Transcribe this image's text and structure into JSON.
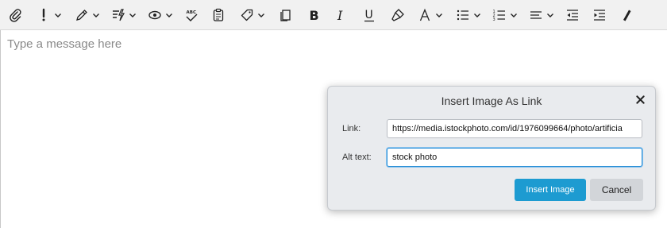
{
  "toolbar": {
    "items": [
      {
        "icon": "paperclip-icon"
      },
      {
        "icon": "priority-icon",
        "dropdown": true
      },
      {
        "icon": "signature-pen-icon",
        "dropdown": true
      },
      {
        "icon": "quick-text-icon",
        "dropdown": true
      },
      {
        "icon": "read-receipt-icon",
        "dropdown": true
      },
      {
        "icon": "spellcheck-icon"
      },
      {
        "icon": "clipboard-icon"
      },
      {
        "icon": "tag-icon",
        "dropdown": true
      },
      {
        "icon": "copy-icon"
      },
      {
        "icon": "bold-icon"
      },
      {
        "icon": "italic-icon"
      },
      {
        "icon": "underline-icon"
      },
      {
        "icon": "format-painter-icon"
      },
      {
        "icon": "font-color-icon",
        "dropdown": true
      },
      {
        "icon": "bullet-list-icon",
        "dropdown": true
      },
      {
        "icon": "numbered-list-icon",
        "dropdown": true
      },
      {
        "icon": "align-icon",
        "dropdown": true
      },
      {
        "icon": "outdent-icon"
      },
      {
        "icon": "indent-icon"
      },
      {
        "icon": "more-icon"
      }
    ]
  },
  "compose": {
    "placeholder": "Type a message here"
  },
  "dialog": {
    "title": "Insert Image As Link",
    "link_label": "Link:",
    "link_value": "https://media.istockphoto.com/id/1976099664/photo/artificia",
    "alt_label": "Alt text:",
    "alt_value": "stock photo",
    "insert_button": "Insert Image",
    "cancel_button": "Cancel"
  },
  "colors": {
    "accent": "#1d9bd1",
    "dialog_bg": "#e9ebee",
    "toolbar_bg": "#f1f1f1",
    "placeholder": "#8a8a8a"
  }
}
